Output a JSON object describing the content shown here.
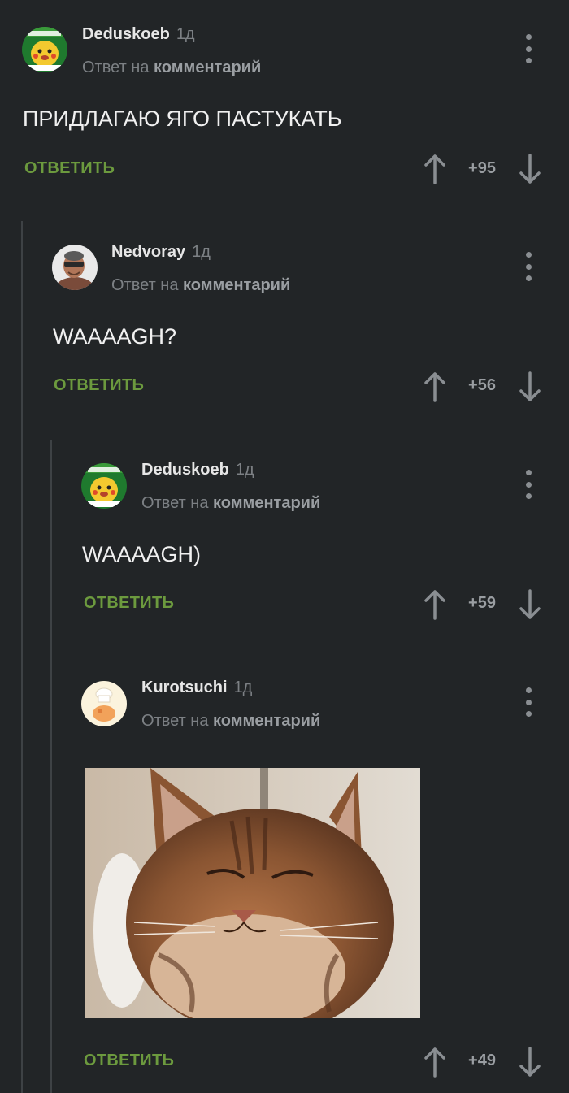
{
  "comments": [
    {
      "author": "Deduskoeb",
      "age": "1д",
      "reply_prefix": "Ответ на",
      "reply_target": "комментарий",
      "text": "ПРИДЛАГАЮ ЯГО ПАСТУКАТЬ",
      "reply_label": "ОТВЕТИТЬ",
      "score": "+95",
      "avatar": "pikachu-avatar"
    },
    {
      "author": "Nedvoray",
      "age": "1д",
      "reply_prefix": "Ответ на",
      "reply_target": "комментарий",
      "text": "WAAAAGH?",
      "reply_label": "ОТВЕТИТЬ",
      "score": "+56",
      "avatar": "bald-man-avatar"
    },
    {
      "author": "Deduskoeb",
      "age": "1д",
      "reply_prefix": "Ответ на",
      "reply_target": "комментарий",
      "text": "WAAAAGH)",
      "reply_label": "ОТВЕТИТЬ",
      "score": "+59",
      "avatar": "pikachu-avatar"
    },
    {
      "author": "Kurotsuchi",
      "age": "1д",
      "reply_prefix": "Ответ на",
      "reply_target": "комментарий",
      "image": "cat-photo",
      "reply_label": "ОТВЕТИТЬ",
      "score": "+49",
      "avatar": "chef-cat-avatar"
    }
  ],
  "colors": {
    "background": "#222527",
    "reply_green": "#6c9a3e",
    "muted": "#7c8084",
    "text": "#f0f0f0"
  }
}
